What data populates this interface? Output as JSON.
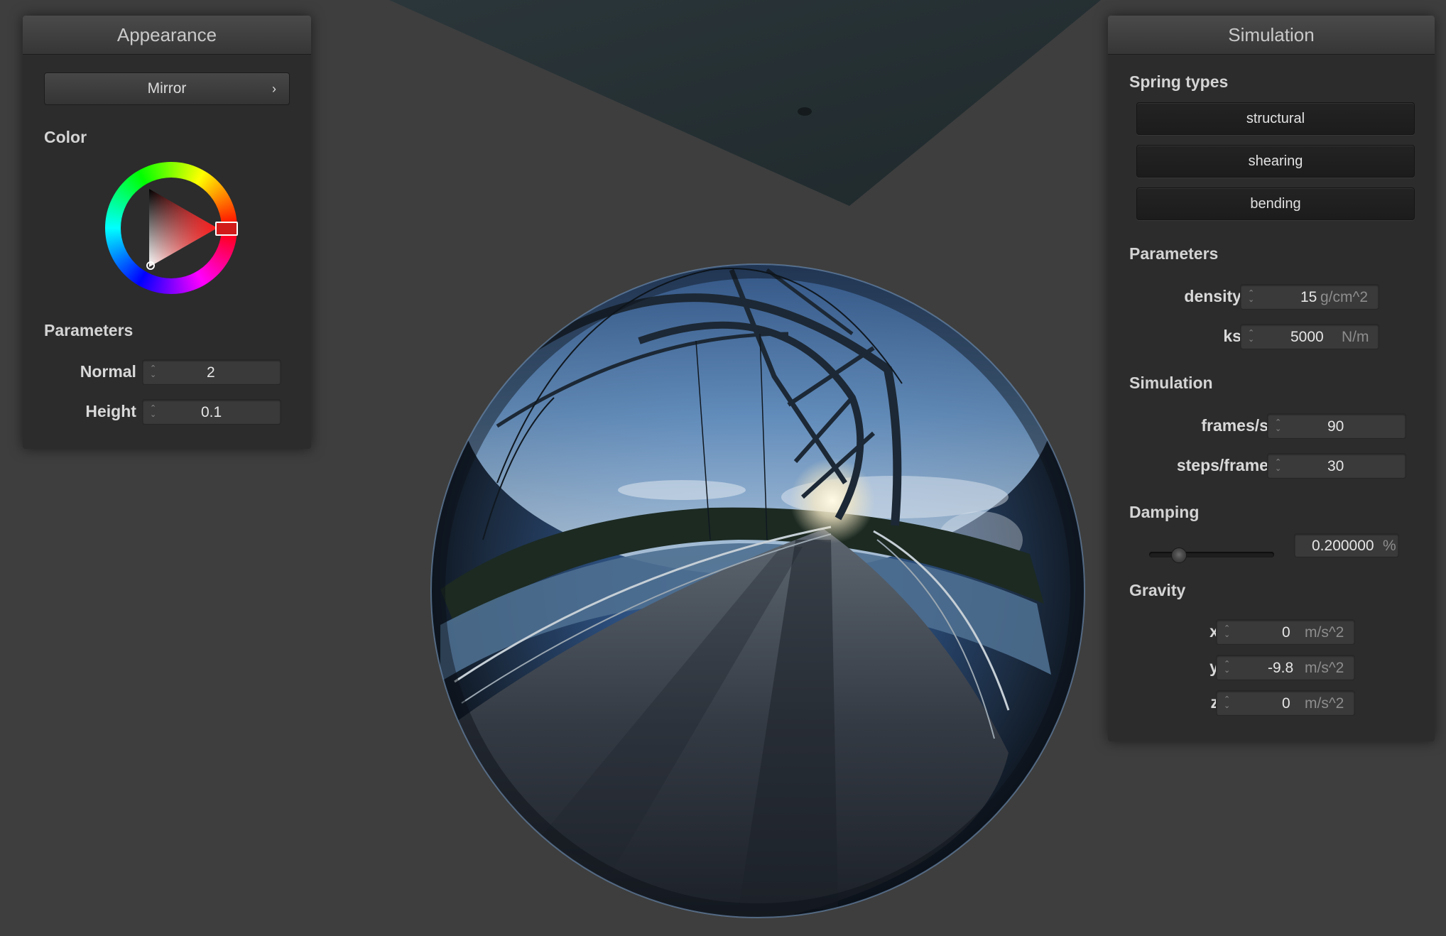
{
  "appearance": {
    "title": "Appearance",
    "shader_select": "Mirror",
    "color_label": "Color",
    "parameters_label": "Parameters",
    "normal_label": "Normal :",
    "normal_value": "2",
    "height_label": "Height :",
    "height_value": "0.1",
    "color_value": "#d11a1a"
  },
  "simulation": {
    "title": "Simulation",
    "spring_types_label": "Spring types",
    "spring_buttons": [
      "structural",
      "shearing",
      "bending"
    ],
    "parameters_label": "Parameters",
    "density_label": "density :",
    "density_value": "15",
    "density_unit": "g/cm^2",
    "ks_label": "ks :",
    "ks_value": "5000",
    "ks_unit": "N/m",
    "simulation_label": "Simulation",
    "fps_label": "frames/s :",
    "fps_value": "90",
    "steps_label": "steps/frame :",
    "steps_value": "30",
    "damping_label": "Damping",
    "damping_value": "0.200000",
    "damping_unit": "%",
    "damping_slider_fraction": 0.2,
    "gravity_label": "Gravity",
    "gx_label": "x :",
    "gx_value": "0",
    "gy_label": "y :",
    "gy_value": "-9.8",
    "gz_label": "z :",
    "gz_value": "0",
    "gravity_unit": "m/s^2"
  },
  "icons": {
    "spinner": "up-down-arrows",
    "dropdown": "chevron-right"
  }
}
